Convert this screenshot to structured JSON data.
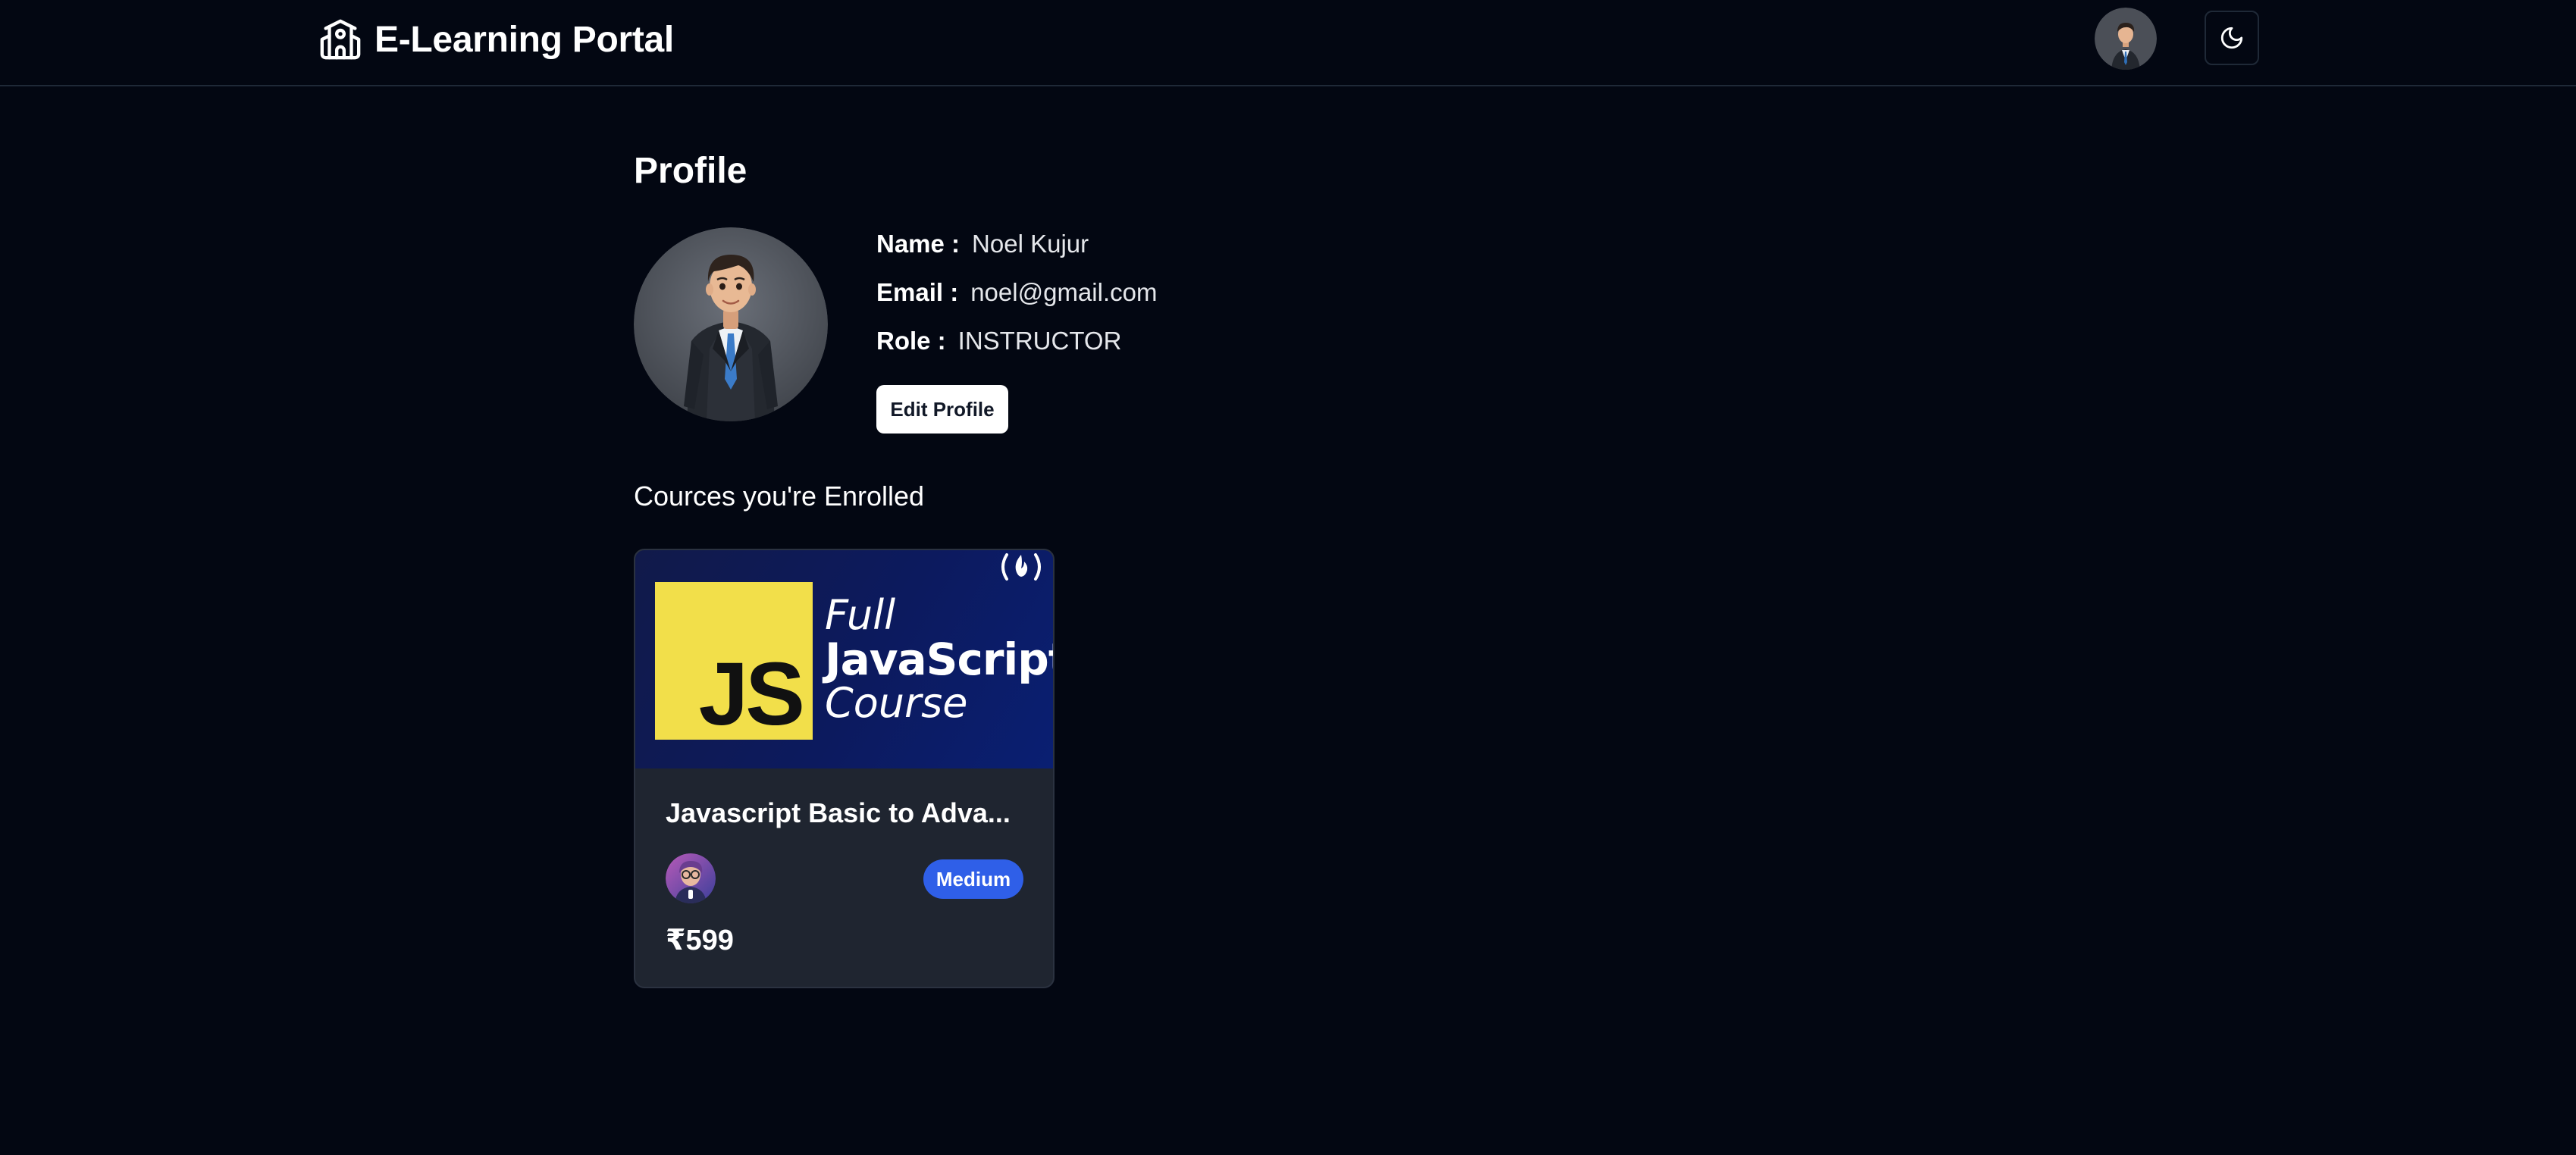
{
  "header": {
    "app_title": "E-Learning Portal",
    "brand_icon": "school-building-icon",
    "avatar_icon": "user-avatar",
    "theme_toggle_icon": "moon-icon"
  },
  "profile": {
    "title": "Profile",
    "name_label": "Name :",
    "name_value": "Noel Kujur",
    "email_label": "Email :",
    "email_value": "noel@gmail.com",
    "role_label": "Role :",
    "role_value": "INSTRUCTOR",
    "edit_button": "Edit Profile"
  },
  "enrolled": {
    "section_title": "Cources you're Enrolled",
    "courses": [
      {
        "thumbnail_line1": "Full",
        "thumbnail_line2": "JavaScript",
        "thumbnail_line3": "Course",
        "thumbnail_badge": "JS",
        "title": "Javascript Basic to Adva...",
        "level": "Medium",
        "price": "₹599"
      }
    ]
  },
  "colors": {
    "background": "#030712",
    "card": "#1f2530",
    "badge": "#2f5fe8",
    "js_yellow": "#f2df4a",
    "thumbnail_navy": "#0c1a5e"
  }
}
